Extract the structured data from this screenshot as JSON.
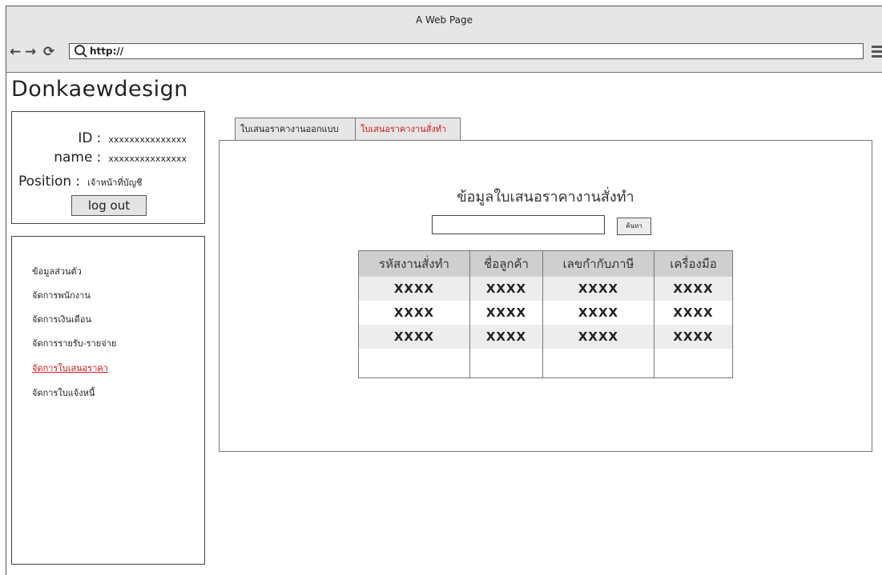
{
  "window": {
    "title": "A Web Page"
  },
  "nav": {
    "url": "http://"
  },
  "logo": "Donkaewdesign",
  "user": {
    "id_label": "ID",
    "id_value": "xxxxxxxxxxxxxxx",
    "name_label": "name",
    "name_value": "xxxxxxxxxxxxxxx",
    "position_label": "Position",
    "position_value": "เจ้าหน้าที่บัญชี",
    "sep": ":",
    "logout": "log out"
  },
  "menu": [
    {
      "label": "ข้อมูลส่วนตัว",
      "active": false
    },
    {
      "label": "จัดการพนักงาน",
      "active": false
    },
    {
      "label": "จัดการเงินเดือน",
      "active": false
    },
    {
      "label": "จัดการรายรับ-รายจ่าย",
      "active": false
    },
    {
      "label": "จัดการใบเสนอราคา",
      "active": true
    },
    {
      "label": "จัดการใบแจ้งหนี้",
      "active": false
    }
  ],
  "tabs": [
    {
      "label": "ใบเสนอราคางานออกแบบ",
      "active": false
    },
    {
      "label": "ใบเสนอราคางานสั่งทำ",
      "active": true
    }
  ],
  "panel": {
    "title": "ข้อมูลใบเสนอราคางานสั่งทำ",
    "search_value": "",
    "search_button": "ค้นหา"
  },
  "table": {
    "headers": [
      "รหัสงานสั่งทำ",
      "ชื่อลูกค้า",
      "เลขกำกับภาษี",
      "เครื่องมือ"
    ],
    "rows": [
      [
        "XXXX",
        "XXXX",
        "XXXX",
        "XXXX"
      ],
      [
        "XXXX",
        "XXXX",
        "XXXX",
        "XXXX"
      ],
      [
        "XXXX",
        "XXXX",
        "XXXX",
        "XXXX"
      ]
    ]
  },
  "colors": {
    "accent_red": "#d01818",
    "header_gray": "#cfcfcf",
    "chrome_gray": "#e6e6e6"
  }
}
